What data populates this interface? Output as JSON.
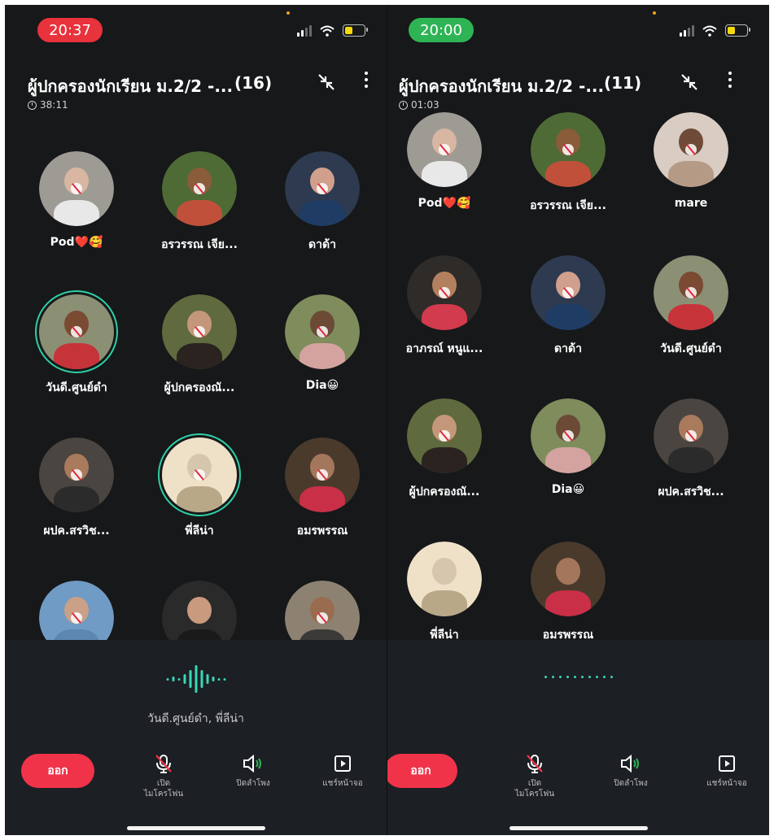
{
  "colors": {
    "background": "#16181a",
    "accent_wave": "#3ad6b8",
    "leave_button": "#f1334a",
    "talk_ring": "#2fcfa4"
  },
  "left": {
    "status_time": "20:37",
    "group_title": "ผู้ปกครองนักเรียน ม.2/2 -...",
    "member_count": "(16)",
    "call_timer": "38:11",
    "participants": [
      {
        "name": "Pod❤️🥰"
      },
      {
        "name": "อรวรรณ เจีย..."
      },
      {
        "name": "ดาด้า"
      },
      {
        "name": "วันดี.ศูนย์ดำ",
        "speaking": true
      },
      {
        "name": "ผู้ปกครองณั..."
      },
      {
        "name": "Dia😀"
      },
      {
        "name": "ผปค.สรวิช..."
      },
      {
        "name": "พี่ลีน่า",
        "speaking": true
      },
      {
        "name": "อมรพรรณ"
      },
      {
        "name": ""
      },
      {
        "name": ""
      },
      {
        "name": ""
      }
    ],
    "speaking_text": "วันดี.ศูนย์ดำ, พี่ลีน่า"
  },
  "right": {
    "status_time": "20:00",
    "group_title": "ผู้ปกครองนักเรียน ม.2/2 -...",
    "member_count": "(11)",
    "call_timer": "01:03",
    "participants": [
      {
        "name": "Pod❤️🥰"
      },
      {
        "name": "อรวรรณ เจีย..."
      },
      {
        "name": "mare"
      },
      {
        "name": "อาภรณ์ หนูแ..."
      },
      {
        "name": "ดาด้า"
      },
      {
        "name": "วันดี.ศูนย์ดำ"
      },
      {
        "name": "ผู้ปกครองณั..."
      },
      {
        "name": "Dia😀"
      },
      {
        "name": "ผปค.สรวิช..."
      },
      {
        "name": "พี่ลีน่า"
      },
      {
        "name": "อมรพรรณ"
      }
    ]
  },
  "controls": {
    "leave_label": "ออก",
    "mic_label_1": "เปิด",
    "mic_label_2": "ไมโครโฟน",
    "speaker_label": "ปิดลำโพง",
    "share_label": "แชร์หน้าจอ"
  },
  "icons": [
    "clock-icon",
    "minimize-icon",
    "more-icon",
    "mic-off-icon",
    "speaker-icon",
    "share-screen-icon",
    "wifi-icon",
    "battery-icon",
    "signal-icon"
  ]
}
